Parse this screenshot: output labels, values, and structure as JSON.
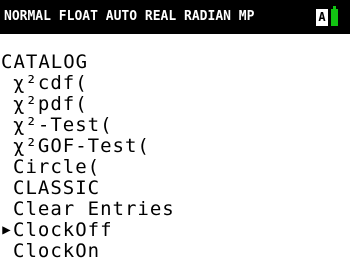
{
  "status_bar": {
    "modes": "NORMAL FLOAT AUTO REAL RADIAN MP",
    "alpha_indicator": "A",
    "battery_icon": "battery-icon",
    "background": "#000000",
    "battery_color": "#12c312"
  },
  "menu": {
    "title": "CATALOG",
    "cursor_glyph": "▶",
    "selected_index": 8,
    "items": [
      {
        "label": "χ²cdf("
      },
      {
        "label": "χ²pdf("
      },
      {
        "label": "χ²-Test("
      },
      {
        "label": "χ²GOF-Test("
      },
      {
        "label": "Circle("
      },
      {
        "label": "CLASSIC"
      },
      {
        "label": "Clear Entries"
      },
      {
        "label": "ClockOff"
      },
      {
        "label": "ClockOn"
      }
    ]
  }
}
